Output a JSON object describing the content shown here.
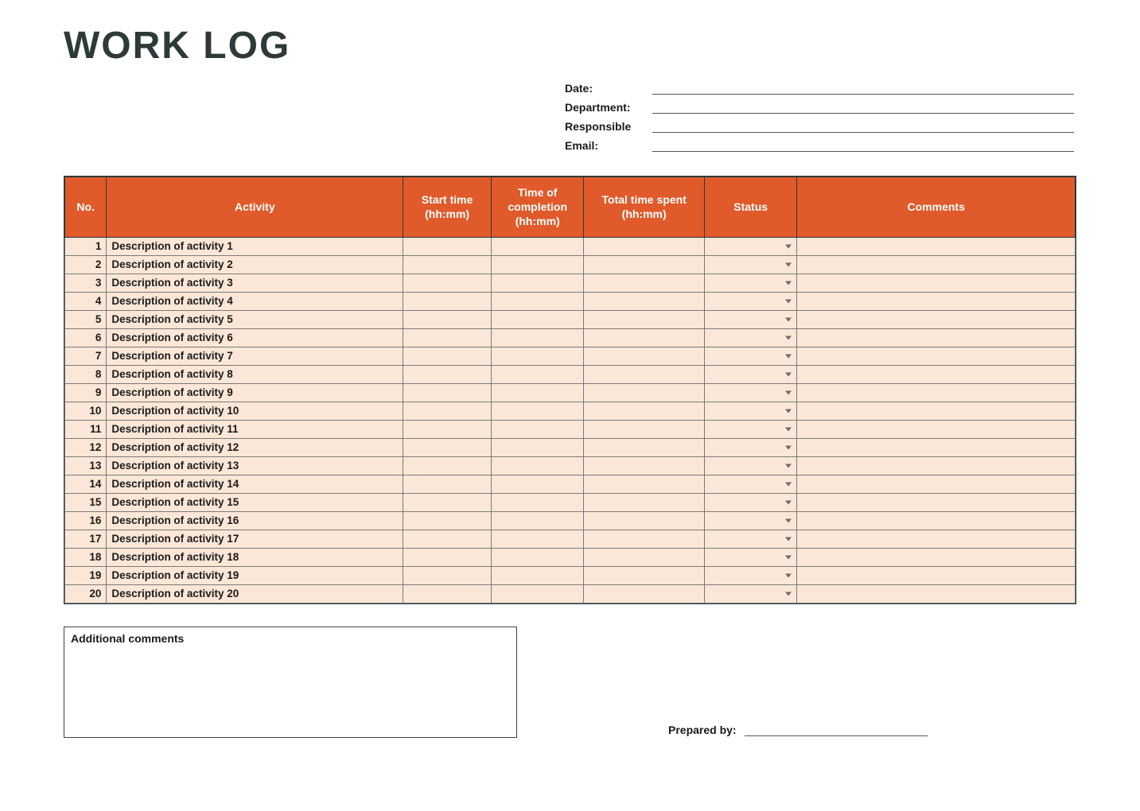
{
  "title": "WORK LOG",
  "meta": {
    "date_label": "Date:",
    "date_value": "",
    "department_label": "Department:",
    "department_value": "",
    "responsible_label": "Responsible",
    "responsible_value": "",
    "email_label": "Email:",
    "email_value": ""
  },
  "columns": {
    "no": "No.",
    "activity": "Activity",
    "start": "Start time (hh:mm)",
    "end": "Time of completion (hh:mm)",
    "total": "Total time spent (hh:mm)",
    "status": "Status",
    "comments": "Comments"
  },
  "rows": [
    {
      "no": "1",
      "activity": "Description of activity 1",
      "start": "",
      "end": "",
      "total": "",
      "status": "",
      "comments": ""
    },
    {
      "no": "2",
      "activity": "Description of activity 2",
      "start": "",
      "end": "",
      "total": "",
      "status": "",
      "comments": ""
    },
    {
      "no": "3",
      "activity": "Description of activity 3",
      "start": "",
      "end": "",
      "total": "",
      "status": "",
      "comments": ""
    },
    {
      "no": "4",
      "activity": "Description of activity 4",
      "start": "",
      "end": "",
      "total": "",
      "status": "",
      "comments": ""
    },
    {
      "no": "5",
      "activity": "Description of activity 5",
      "start": "",
      "end": "",
      "total": "",
      "status": "",
      "comments": ""
    },
    {
      "no": "6",
      "activity": "Description of activity 6",
      "start": "",
      "end": "",
      "total": "",
      "status": "",
      "comments": ""
    },
    {
      "no": "7",
      "activity": "Description of activity 7",
      "start": "",
      "end": "",
      "total": "",
      "status": "",
      "comments": ""
    },
    {
      "no": "8",
      "activity": "Description of activity 8",
      "start": "",
      "end": "",
      "total": "",
      "status": "",
      "comments": ""
    },
    {
      "no": "9",
      "activity": "Description of activity 9",
      "start": "",
      "end": "",
      "total": "",
      "status": "",
      "comments": ""
    },
    {
      "no": "10",
      "activity": "Description of activity 10",
      "start": "",
      "end": "",
      "total": "",
      "status": "",
      "comments": ""
    },
    {
      "no": "11",
      "activity": "Description of activity 11",
      "start": "",
      "end": "",
      "total": "",
      "status": "",
      "comments": ""
    },
    {
      "no": "12",
      "activity": "Description of activity 12",
      "start": "",
      "end": "",
      "total": "",
      "status": "",
      "comments": ""
    },
    {
      "no": "13",
      "activity": "Description of activity 13",
      "start": "",
      "end": "",
      "total": "",
      "status": "",
      "comments": ""
    },
    {
      "no": "14",
      "activity": "Description of activity 14",
      "start": "",
      "end": "",
      "total": "",
      "status": "",
      "comments": ""
    },
    {
      "no": "15",
      "activity": "Description of activity 15",
      "start": "",
      "end": "",
      "total": "",
      "status": "",
      "comments": ""
    },
    {
      "no": "16",
      "activity": "Description of activity 16",
      "start": "",
      "end": "",
      "total": "",
      "status": "",
      "comments": ""
    },
    {
      "no": "17",
      "activity": "Description of activity 17",
      "start": "",
      "end": "",
      "total": "",
      "status": "",
      "comments": ""
    },
    {
      "no": "18",
      "activity": "Description of activity 18",
      "start": "",
      "end": "",
      "total": "",
      "status": "",
      "comments": ""
    },
    {
      "no": "19",
      "activity": "Description of activity 19",
      "start": "",
      "end": "",
      "total": "",
      "status": "",
      "comments": ""
    },
    {
      "no": "20",
      "activity": "Description of activity 20",
      "start": "",
      "end": "",
      "total": "",
      "status": "",
      "comments": ""
    }
  ],
  "additional_label": "Additional comments",
  "additional_value": "",
  "prepared_label": "Prepared by:",
  "prepared_value": ""
}
